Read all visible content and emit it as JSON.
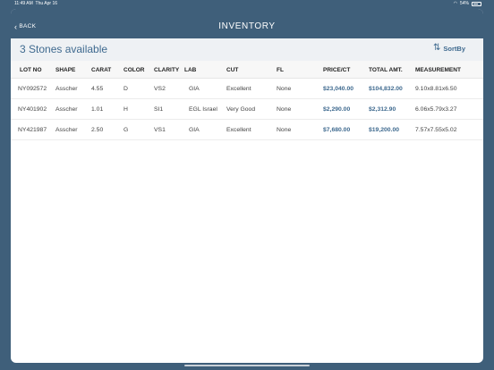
{
  "status": {
    "time": "11:49 AM",
    "date": "Thu Apr 16",
    "battery": "54%"
  },
  "nav": {
    "back_label": "BACK",
    "title": "INVENTORY"
  },
  "subheader": {
    "count_text": "3 Stones available",
    "sort_label": "SortBy"
  },
  "table": {
    "columns": [
      "LOT NO",
      "SHAPE",
      "CARAT",
      "COLOR",
      "CLARITY",
      "LAB",
      "CUT",
      "FL",
      "PRICE/CT",
      "TOTAL AMT.",
      "MEASUREMENT"
    ],
    "rows": [
      [
        "NY092572",
        "Asscher",
        "4.55",
        "D",
        "VS2",
        "GIA",
        "Excellent",
        "None",
        "$23,040.00",
        "$104,832.00",
        "9.10x8.81x6.50"
      ],
      [
        "NY401902",
        "Asscher",
        "1.01",
        "H",
        "SI1",
        "EGL Israel",
        "Very Good",
        "None",
        "$2,290.00",
        "$2,312.90",
        "6.06x5.79x3.27"
      ],
      [
        "NY421987",
        "Asscher",
        "2.50",
        "G",
        "VS1",
        "GIA",
        "Excellent",
        "None",
        "$7,680.00",
        "$19,200.00",
        "7.57x7.55x5.02"
      ]
    ]
  },
  "colors": {
    "navbar": "#3f5f7a",
    "accent": "#3f6a8f",
    "subbar": "#eef1f4"
  },
  "icons": {
    "back": "chevron-left-icon",
    "sort": "sort-arrows-icon",
    "wifi": "wifi-icon",
    "battery": "battery-icon"
  }
}
